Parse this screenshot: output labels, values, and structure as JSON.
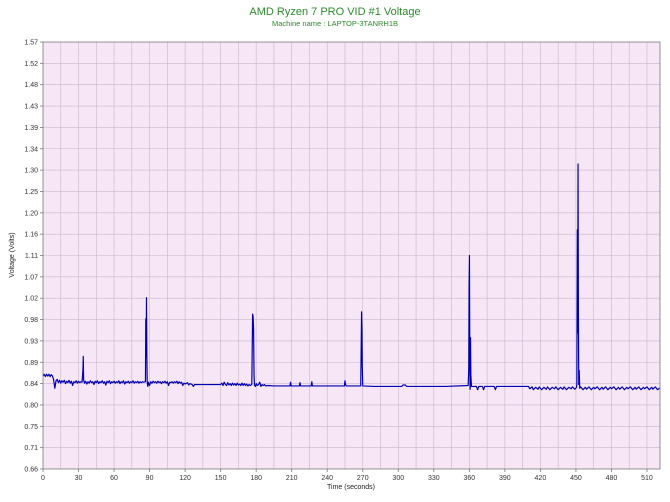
{
  "chart_data": {
    "type": "line",
    "title": "AMD Ryzen 7 PRO VID #1 Voltage",
    "subtitle": "Machine name : LAPTOP-3TANRH1B",
    "xlabel": "Time (seconds)",
    "ylabel": "Voltage (Volts)",
    "xlim": [
      0,
      521
    ],
    "ylim": [
      0.66,
      1.57
    ],
    "xticks": [
      "0",
      "30",
      "60",
      "90",
      "120",
      "150",
      "180",
      "210",
      "240",
      "270",
      "300",
      "330",
      "360",
      "390",
      "420",
      "450",
      "480",
      "510"
    ],
    "yticks": [
      "0.66",
      "0.71",
      "0.75",
      "0.80",
      "0.84",
      "0.89",
      "0.93",
      "0.98",
      "1.02",
      "1.07",
      "1.11",
      "1.16",
      "1.20",
      "1.25",
      "1.30",
      "1.34",
      "1.39",
      "1.43",
      "1.48",
      "1.52",
      "1.57"
    ],
    "grid": true,
    "colors": {
      "title": "#2b8a2b",
      "subtitle": "#2b8a2b",
      "line": "#0000b2",
      "plot_background": "#f6e6f6",
      "grid": "#c9b5cb",
      "axis": "#7a7a7a"
    },
    "series": [
      {
        "points": [
          [
            0,
            0.858
          ],
          [
            1,
            0.862
          ],
          [
            2,
            0.857
          ],
          [
            3,
            0.862
          ],
          [
            4,
            0.858
          ],
          [
            5,
            0.862
          ],
          [
            6,
            0.857
          ],
          [
            7,
            0.861
          ],
          [
            8,
            0.858
          ],
          [
            9,
            0.85
          ],
          [
            10,
            0.832
          ],
          [
            11,
            0.848
          ],
          [
            12,
            0.851
          ],
          [
            13,
            0.844
          ],
          [
            14,
            0.849
          ],
          [
            15,
            0.843
          ],
          [
            16,
            0.848
          ],
          [
            17,
            0.845
          ],
          [
            18,
            0.849
          ],
          [
            19,
            0.842
          ],
          [
            20,
            0.847
          ],
          [
            21,
            0.844
          ],
          [
            22,
            0.849
          ],
          [
            23,
            0.843
          ],
          [
            24,
            0.847
          ],
          [
            25,
            0.838
          ],
          [
            26,
            0.846
          ],
          [
            27,
            0.844
          ],
          [
            28,
            0.848
          ],
          [
            29,
            0.843
          ],
          [
            30,
            0.847
          ],
          [
            31,
            0.844
          ],
          [
            32,
            0.846
          ],
          [
            33,
            0.845
          ],
          [
            33.7,
            0.87
          ],
          [
            34,
            0.9
          ],
          [
            34.3,
            0.85
          ],
          [
            35,
            0.843
          ],
          [
            36,
            0.847
          ],
          [
            37,
            0.841
          ],
          [
            38,
            0.846
          ],
          [
            39,
            0.843
          ],
          [
            40,
            0.848
          ],
          [
            41,
            0.844
          ],
          [
            42,
            0.846
          ],
          [
            43,
            0.84
          ],
          [
            44,
            0.847
          ],
          [
            45,
            0.844
          ],
          [
            46,
            0.848
          ],
          [
            47,
            0.842
          ],
          [
            48,
            0.846
          ],
          [
            49,
            0.844
          ],
          [
            50,
            0.848
          ],
          [
            51,
            0.843
          ],
          [
            52,
            0.846
          ],
          [
            53,
            0.839
          ],
          [
            54,
            0.847
          ],
          [
            55,
            0.844
          ],
          [
            56,
            0.848
          ],
          [
            57,
            0.842
          ],
          [
            58,
            0.846
          ],
          [
            59,
            0.844
          ],
          [
            60,
            0.847
          ],
          [
            61,
            0.843
          ],
          [
            62,
            0.846
          ],
          [
            63,
            0.844
          ],
          [
            64,
            0.848
          ],
          [
            65,
            0.842
          ],
          [
            66,
            0.846
          ],
          [
            67,
            0.844
          ],
          [
            68,
            0.848
          ],
          [
            69,
            0.841
          ],
          [
            70,
            0.846
          ],
          [
            71,
            0.844
          ],
          [
            72,
            0.847
          ],
          [
            73,
            0.843
          ],
          [
            74,
            0.846
          ],
          [
            75,
            0.844
          ],
          [
            76,
            0.848
          ],
          [
            77,
            0.843
          ],
          [
            78,
            0.846
          ],
          [
            79,
            0.844
          ],
          [
            80,
            0.847
          ],
          [
            81,
            0.843
          ],
          [
            82,
            0.846
          ],
          [
            83,
            0.844
          ],
          [
            84,
            0.846
          ],
          [
            85,
            0.845
          ],
          [
            86.5,
            0.846
          ],
          [
            86.8,
            0.98
          ],
          [
            87.1,
            0.9
          ],
          [
            87.4,
            1.025
          ],
          [
            87.7,
            0.9
          ],
          [
            88,
            0.845
          ],
          [
            88.5,
            0.836
          ],
          [
            89,
            0.845
          ],
          [
            90,
            0.838
          ],
          [
            91,
            0.846
          ],
          [
            92,
            0.843
          ],
          [
            93,
            0.847
          ],
          [
            94,
            0.844
          ],
          [
            95,
            0.846
          ],
          [
            96,
            0.843
          ],
          [
            97,
            0.847
          ],
          [
            98,
            0.844
          ],
          [
            99,
            0.846
          ],
          [
            100,
            0.842
          ],
          [
            101,
            0.846
          ],
          [
            102,
            0.844
          ],
          [
            103,
            0.847
          ],
          [
            104,
            0.843
          ],
          [
            105,
            0.846
          ],
          [
            106,
            0.838
          ],
          [
            107,
            0.845
          ],
          [
            108,
            0.844
          ],
          [
            109,
            0.846
          ],
          [
            110,
            0.843
          ],
          [
            111,
            0.846
          ],
          [
            112,
            0.844
          ],
          [
            113,
            0.847
          ],
          [
            114,
            0.842
          ],
          [
            115,
            0.846
          ],
          [
            116,
            0.843
          ],
          [
            117,
            0.845
          ],
          [
            118,
            0.838
          ],
          [
            119,
            0.843
          ],
          [
            120,
            0.841
          ],
          [
            122,
            0.844
          ],
          [
            123,
            0.839
          ],
          [
            124,
            0.842
          ],
          [
            126,
            0.84
          ],
          [
            127,
            0.836
          ],
          [
            128,
            0.84
          ],
          [
            135,
            0.84
          ],
          [
            140,
            0.84
          ],
          [
            145,
            0.84
          ],
          [
            150,
            0.84
          ],
          [
            151,
            0.843
          ],
          [
            152,
            0.838
          ],
          [
            153,
            0.845
          ],
          [
            154,
            0.84
          ],
          [
            155,
            0.838
          ],
          [
            156,
            0.844
          ],
          [
            157,
            0.839
          ],
          [
            158,
            0.842
          ],
          [
            159,
            0.838
          ],
          [
            160,
            0.843
          ],
          [
            161,
            0.839
          ],
          [
            162,
            0.842
          ],
          [
            163,
            0.838
          ],
          [
            164,
            0.843
          ],
          [
            165,
            0.839
          ],
          [
            166,
            0.841
          ],
          [
            167,
            0.838
          ],
          [
            168,
            0.843
          ],
          [
            169,
            0.838
          ],
          [
            170,
            0.842
          ],
          [
            171,
            0.838
          ],
          [
            172,
            0.841
          ],
          [
            173,
            0.837
          ],
          [
            174,
            0.84
          ],
          [
            175,
            0.838
          ],
          [
            176.3,
            0.84
          ],
          [
            176.6,
            0.9
          ],
          [
            177,
            0.99
          ],
          [
            177.4,
            0.985
          ],
          [
            177.8,
            0.96
          ],
          [
            178.2,
            0.86
          ],
          [
            178.6,
            0.838
          ],
          [
            179.5,
            0.836
          ],
          [
            180,
            0.842
          ],
          [
            181,
            0.838
          ],
          [
            182,
            0.84
          ],
          [
            183,
            0.845
          ],
          [
            184,
            0.836
          ],
          [
            185,
            0.84
          ],
          [
            186,
            0.838
          ],
          [
            187,
            0.84
          ],
          [
            188,
            0.837
          ],
          [
            190,
            0.838
          ],
          [
            195,
            0.837
          ],
          [
            200,
            0.837
          ],
          [
            205,
            0.837
          ],
          [
            208.5,
            0.837
          ],
          [
            209,
            0.845
          ],
          [
            209.5,
            0.837
          ],
          [
            216.5,
            0.837
          ],
          [
            217,
            0.844
          ],
          [
            217.5,
            0.837
          ],
          [
            226.5,
            0.837
          ],
          [
            227,
            0.846
          ],
          [
            227.5,
            0.837
          ],
          [
            240,
            0.837
          ],
          [
            254.5,
            0.837
          ],
          [
            255,
            0.848
          ],
          [
            255.5,
            0.84
          ],
          [
            256,
            0.837
          ],
          [
            268.3,
            0.837
          ],
          [
            268.6,
            0.9
          ],
          [
            269,
            0.995
          ],
          [
            269.3,
            0.96
          ],
          [
            269.6,
            0.88
          ],
          [
            270,
            0.837
          ],
          [
            280,
            0.836
          ],
          [
            290,
            0.836
          ],
          [
            300,
            0.836
          ],
          [
            303,
            0.836
          ],
          [
            304,
            0.839
          ],
          [
            306,
            0.839
          ],
          [
            307,
            0.836
          ],
          [
            320,
            0.836
          ],
          [
            340,
            0.836
          ],
          [
            359,
            0.838
          ],
          [
            359.5,
            0.87
          ],
          [
            359.8,
            1.05
          ],
          [
            360.1,
            1.115
          ],
          [
            360.4,
            0.9
          ],
          [
            360.7,
            0.83
          ],
          [
            361,
            0.94
          ],
          [
            361.3,
            0.86
          ],
          [
            361.8,
            0.836
          ],
          [
            366,
            0.836
          ],
          [
            367,
            0.829
          ],
          [
            368,
            0.836
          ],
          [
            371,
            0.836
          ],
          [
            372,
            0.829
          ],
          [
            373,
            0.836
          ],
          [
            381,
            0.836
          ],
          [
            382,
            0.829
          ],
          [
            383,
            0.836
          ],
          [
            390,
            0.836
          ],
          [
            400,
            0.836
          ],
          [
            410,
            0.836
          ],
          [
            411,
            0.831
          ],
          [
            413,
            0.835
          ],
          [
            414,
            0.829
          ],
          [
            416,
            0.834
          ],
          [
            418,
            0.83
          ],
          [
            419,
            0.835
          ],
          [
            421,
            0.829
          ],
          [
            423,
            0.834
          ],
          [
            425,
            0.83
          ],
          [
            426,
            0.835
          ],
          [
            428,
            0.829
          ],
          [
            430,
            0.834
          ],
          [
            432,
            0.831
          ],
          [
            433,
            0.835
          ],
          [
            435,
            0.829
          ],
          [
            437,
            0.834
          ],
          [
            439,
            0.83
          ],
          [
            440,
            0.835
          ],
          [
            442,
            0.829
          ],
          [
            444,
            0.834
          ],
          [
            446,
            0.831
          ],
          [
            447,
            0.835
          ],
          [
            449,
            0.83
          ],
          [
            450.5,
            0.834
          ],
          [
            450.8,
            0.84
          ],
          [
            451.2,
            1.17
          ],
          [
            451.5,
            0.95
          ],
          [
            451.8,
            1.31
          ],
          [
            452.1,
            1.0
          ],
          [
            452.4,
            0.84
          ],
          [
            452.8,
            0.87
          ],
          [
            453.2,
            0.832
          ],
          [
            454,
            0.835
          ],
          [
            456,
            0.829
          ],
          [
            458,
            0.834
          ],
          [
            459,
            0.83
          ],
          [
            461,
            0.835
          ],
          [
            463,
            0.829
          ],
          [
            465,
            0.834
          ],
          [
            466,
            0.831
          ],
          [
            468,
            0.835
          ],
          [
            470,
            0.829
          ],
          [
            472,
            0.834
          ],
          [
            473,
            0.83
          ],
          [
            475,
            0.835
          ],
          [
            477,
            0.829
          ],
          [
            479,
            0.834
          ],
          [
            480,
            0.831
          ],
          [
            482,
            0.835
          ],
          [
            484,
            0.829
          ],
          [
            486,
            0.834
          ],
          [
            487,
            0.83
          ],
          [
            489,
            0.835
          ],
          [
            491,
            0.829
          ],
          [
            493,
            0.834
          ],
          [
            494,
            0.831
          ],
          [
            496,
            0.835
          ],
          [
            498,
            0.829
          ],
          [
            500,
            0.834
          ],
          [
            501,
            0.83
          ],
          [
            503,
            0.835
          ],
          [
            505,
            0.829
          ],
          [
            507,
            0.834
          ],
          [
            508,
            0.831
          ],
          [
            510,
            0.835
          ],
          [
            512,
            0.829
          ],
          [
            514,
            0.834
          ],
          [
            515,
            0.83
          ],
          [
            517,
            0.835
          ],
          [
            519,
            0.829
          ],
          [
            521,
            0.833
          ]
        ]
      }
    ]
  }
}
